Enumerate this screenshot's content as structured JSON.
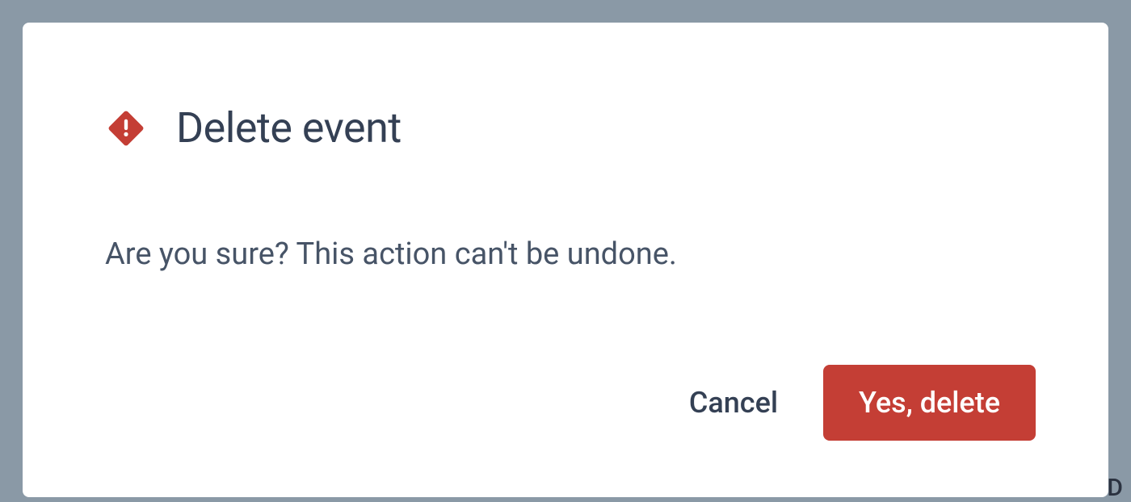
{
  "dialog": {
    "title": "Delete event",
    "message": "Are you sure? This action can't be undone.",
    "cancel_label": "Cancel",
    "confirm_label": "Yes, delete",
    "icon": "warning-icon"
  },
  "colors": {
    "danger": "#C43E35",
    "text_primary": "#344054",
    "text_secondary": "#475467"
  }
}
